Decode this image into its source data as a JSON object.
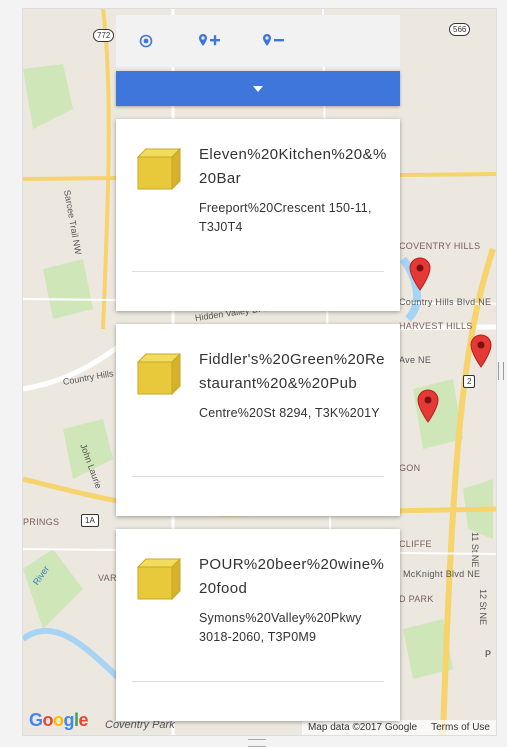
{
  "toolbar": {
    "locate_icon": "target-icon",
    "add_marker_icon": "pin-plus-icon",
    "remove_marker_icon": "pin-minus-icon",
    "accent": "#3f76db"
  },
  "dropdown": {
    "icon": "caret-down-icon",
    "color": "#3f76db"
  },
  "places": [
    {
      "name": "Eleven%20Kitchen%20&%20Bar",
      "address": "Freeport%20Crescent 150-11, T3J0T4"
    },
    {
      "name": "Fiddler's%20Green%20Restaurant%20&%20Pub",
      "address": "Centre%20St 8294, T3K%201Y"
    },
    {
      "name": "POUR%20beer%20wine%20food",
      "address": "Symons%20Valley%20Pkwy 3018-2060, T3P0M9"
    }
  ],
  "map": {
    "labels": {
      "coventry_hills": "COVENTRY HILLS",
      "country_hills_blvd": "Country Hills Blvd NE",
      "harvest_hills": "HARVEST HILLS",
      "ave_ne": "Ave NE",
      "hidden_valley": "Hidden Valley Dr NW",
      "country_hills_road": "Country Hills",
      "john_laurie": "John Laurie",
      "springs": "PRINGS",
      "vars": "VARS",
      "river": "River",
      "gon": "GON",
      "cliffe": "CLIFFE",
      "mcknight": "McKnight Blvd NE",
      "d_park": "D PARK",
      "eleventh_st": "11 St NE",
      "twelfth_st": "12 St NE",
      "sarcee": "Sarcee Trail NW",
      "p_label": "P"
    },
    "shields": {
      "h772": "772",
      "h566": "566",
      "h2": "2",
      "h1a": "1A"
    },
    "logo_letters": [
      "G",
      "o",
      "o",
      "g",
      "l",
      "e"
    ],
    "park_label": "Coventry Park",
    "attribution": "Map data ©2017 Google",
    "terms": "Terms of Use",
    "marker_color": "#e53935"
  }
}
